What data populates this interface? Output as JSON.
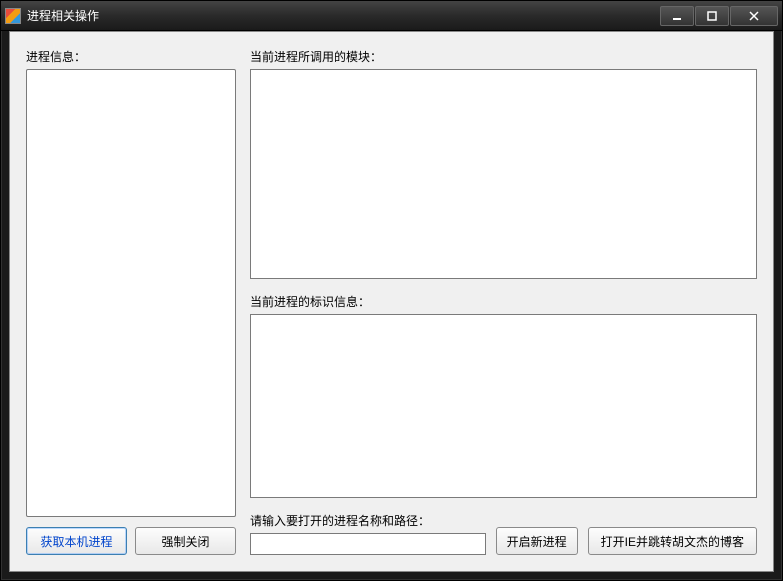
{
  "window": {
    "title": "进程相关操作"
  },
  "labels": {
    "processInfo": "进程信息：",
    "modules": "当前进程所调用的模块：",
    "idInfo": "当前进程的标识信息：",
    "pathPrompt": "请输入要打开的进程名称和路径："
  },
  "buttons": {
    "getLocal": "获取本机进程",
    "forceClose": "强制关闭",
    "startNew": "开启新进程",
    "openIE": "打开IE并跳转胡文杰的博客"
  },
  "inputs": {
    "pathValue": ""
  }
}
